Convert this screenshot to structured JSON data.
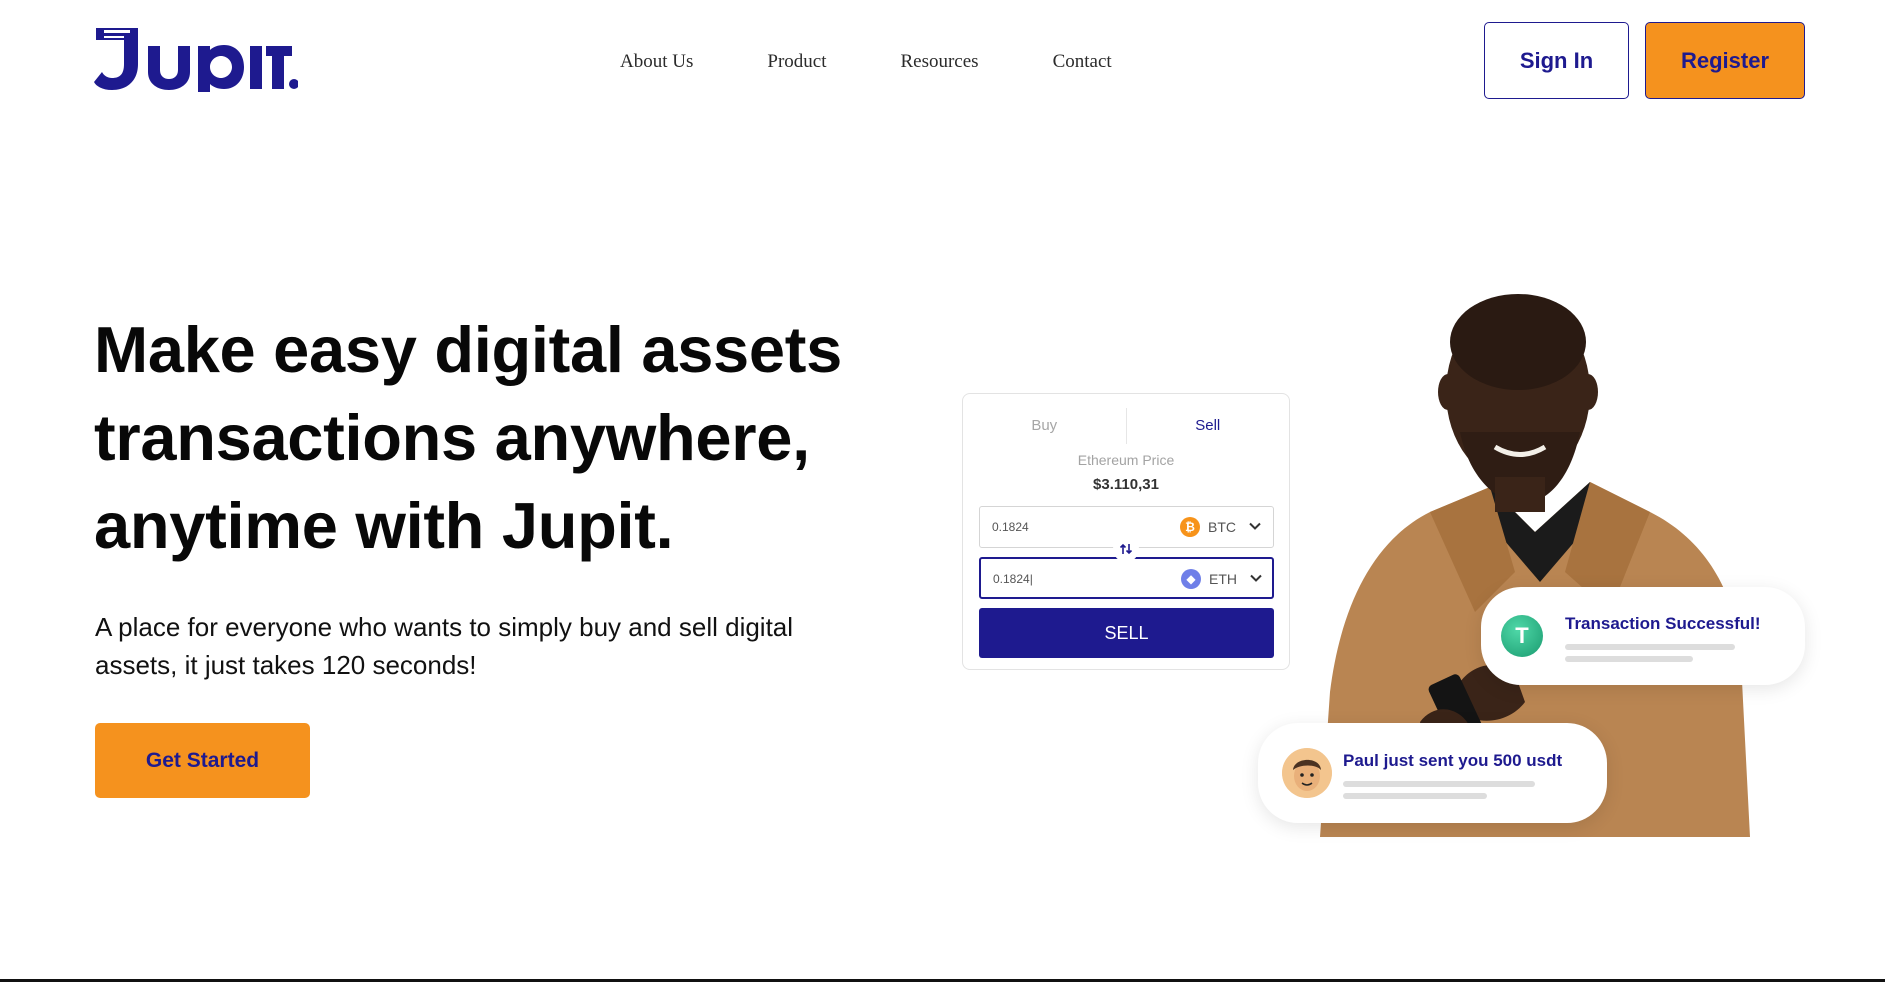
{
  "brand": {
    "name": "Jupit.",
    "primary_color": "#1e1a8f",
    "accent_color": "#f5921e"
  },
  "nav": {
    "links": [
      "About Us",
      "Product",
      "Resources",
      "Contact"
    ],
    "sign_in": "Sign In",
    "register": "Register"
  },
  "hero": {
    "title_lines": [
      "Make easy digital assets",
      "transactions anywhere,",
      "anytime with Jupit."
    ],
    "subtitle_lines": [
      "A place for everyone who wants to simply buy and sell digital",
      "assets, it just takes 120 seconds!"
    ],
    "cta": "Get Started"
  },
  "trade_card": {
    "tabs": [
      "Buy",
      "Sell"
    ],
    "active_tab": "Sell",
    "price_label": "Ethereum Price",
    "price_value": "$3.110,31",
    "from": {
      "amount": "0.1824",
      "currency": "BTC",
      "icon": "bitcoin-icon"
    },
    "to": {
      "amount": "0.1824|",
      "currency": "ETH",
      "icon": "ethereum-icon"
    },
    "swap_icon": "swap-arrows-icon",
    "button": "SELL"
  },
  "notifications": [
    {
      "text": "Transaction Successful!",
      "icon": "tether-icon"
    },
    {
      "text": "Paul just sent you 500 usdt",
      "icon": "avatar"
    }
  ]
}
